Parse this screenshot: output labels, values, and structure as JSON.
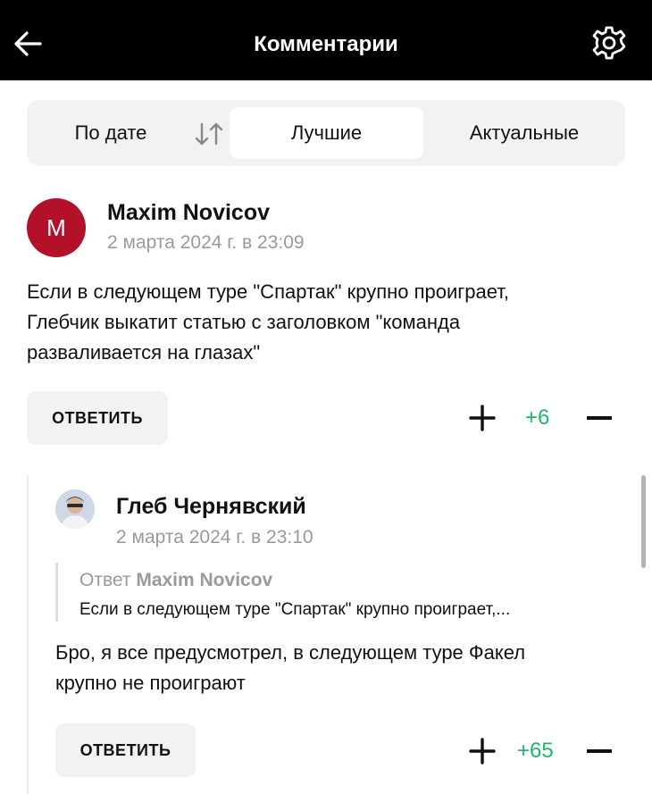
{
  "header": {
    "title": "Комментарии"
  },
  "sort": {
    "by_date": "По дате",
    "best": "Лучшие",
    "actual": "Актуальные"
  },
  "comments": [
    {
      "avatar_letter": "M",
      "author": "Maxim Novicov",
      "date": "2 марта 2024 г. в 23:09",
      "text_lines": [
        "Если в следующем туре \"Спартак\" крупно проиграет,",
        "Глебчик выкатит статью с заголовком \"команда",
        "разваливается на глазах\""
      ],
      "reply_label": "ОТВЕТИТЬ",
      "score": "+6"
    },
    {
      "author": "Глеб Чернявский",
      "date": "2 марта 2024 г. в 23:10",
      "quote_prefix": "Ответ",
      "quote_author": "Maxim Novicov",
      "quote_text": "Если в следующем туре \"Спартак\" крупно проиграет,...",
      "text_lines": [
        "Бро, я все предусмотрел, в следующем туре Факел",
        "крупно не проиграют"
      ],
      "reply_label": "ОТВЕТИТЬ",
      "score": "+65"
    }
  ],
  "colors": {
    "accent_positive": "#1fb76e",
    "avatar_m": "#b3112a",
    "topbar": "#000000"
  },
  "icons": [
    "back-arrow-icon",
    "gear-icon",
    "sort-arrows-icon",
    "plus-icon",
    "minus-icon"
  ]
}
